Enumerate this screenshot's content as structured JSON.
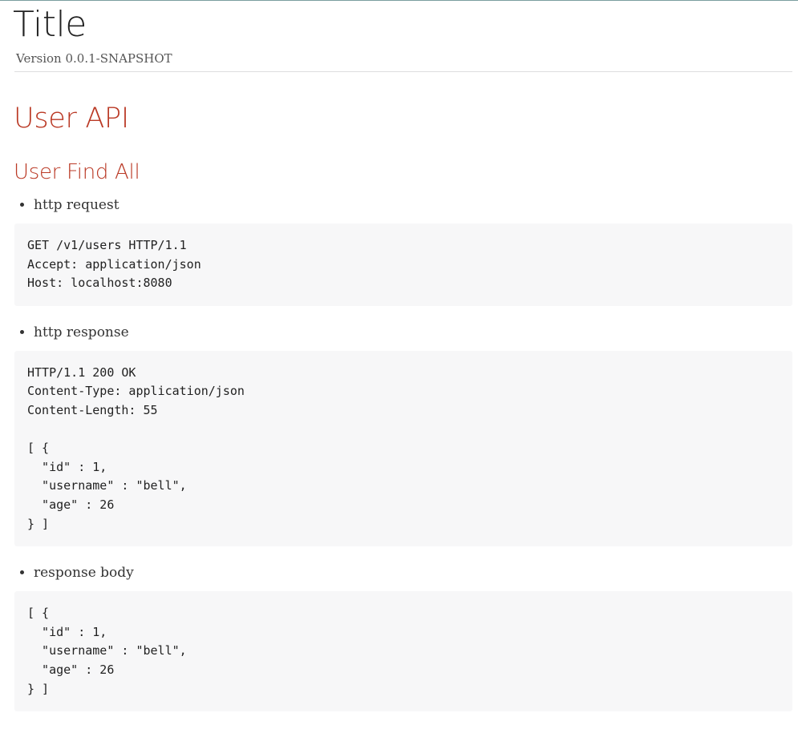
{
  "header": {
    "title": "Title",
    "version": "Version 0.0.1-SNAPSHOT"
  },
  "section": {
    "title": "User API",
    "subsection": {
      "title": "User Find All",
      "blocks": [
        {
          "label": "http request",
          "code": "GET /v1/users HTTP/1.1\nAccept: application/json\nHost: localhost:8080"
        },
        {
          "label": "http response",
          "code": "HTTP/1.1 200 OK\nContent-Type: application/json\nContent-Length: 55\n\n[ {\n  \"id\" : 1,\n  \"username\" : \"bell\",\n  \"age\" : 26\n} ]"
        },
        {
          "label": "response body",
          "code": "[ {\n  \"id\" : 1,\n  \"username\" : \"bell\",\n  \"age\" : 26\n} ]"
        }
      ]
    }
  }
}
